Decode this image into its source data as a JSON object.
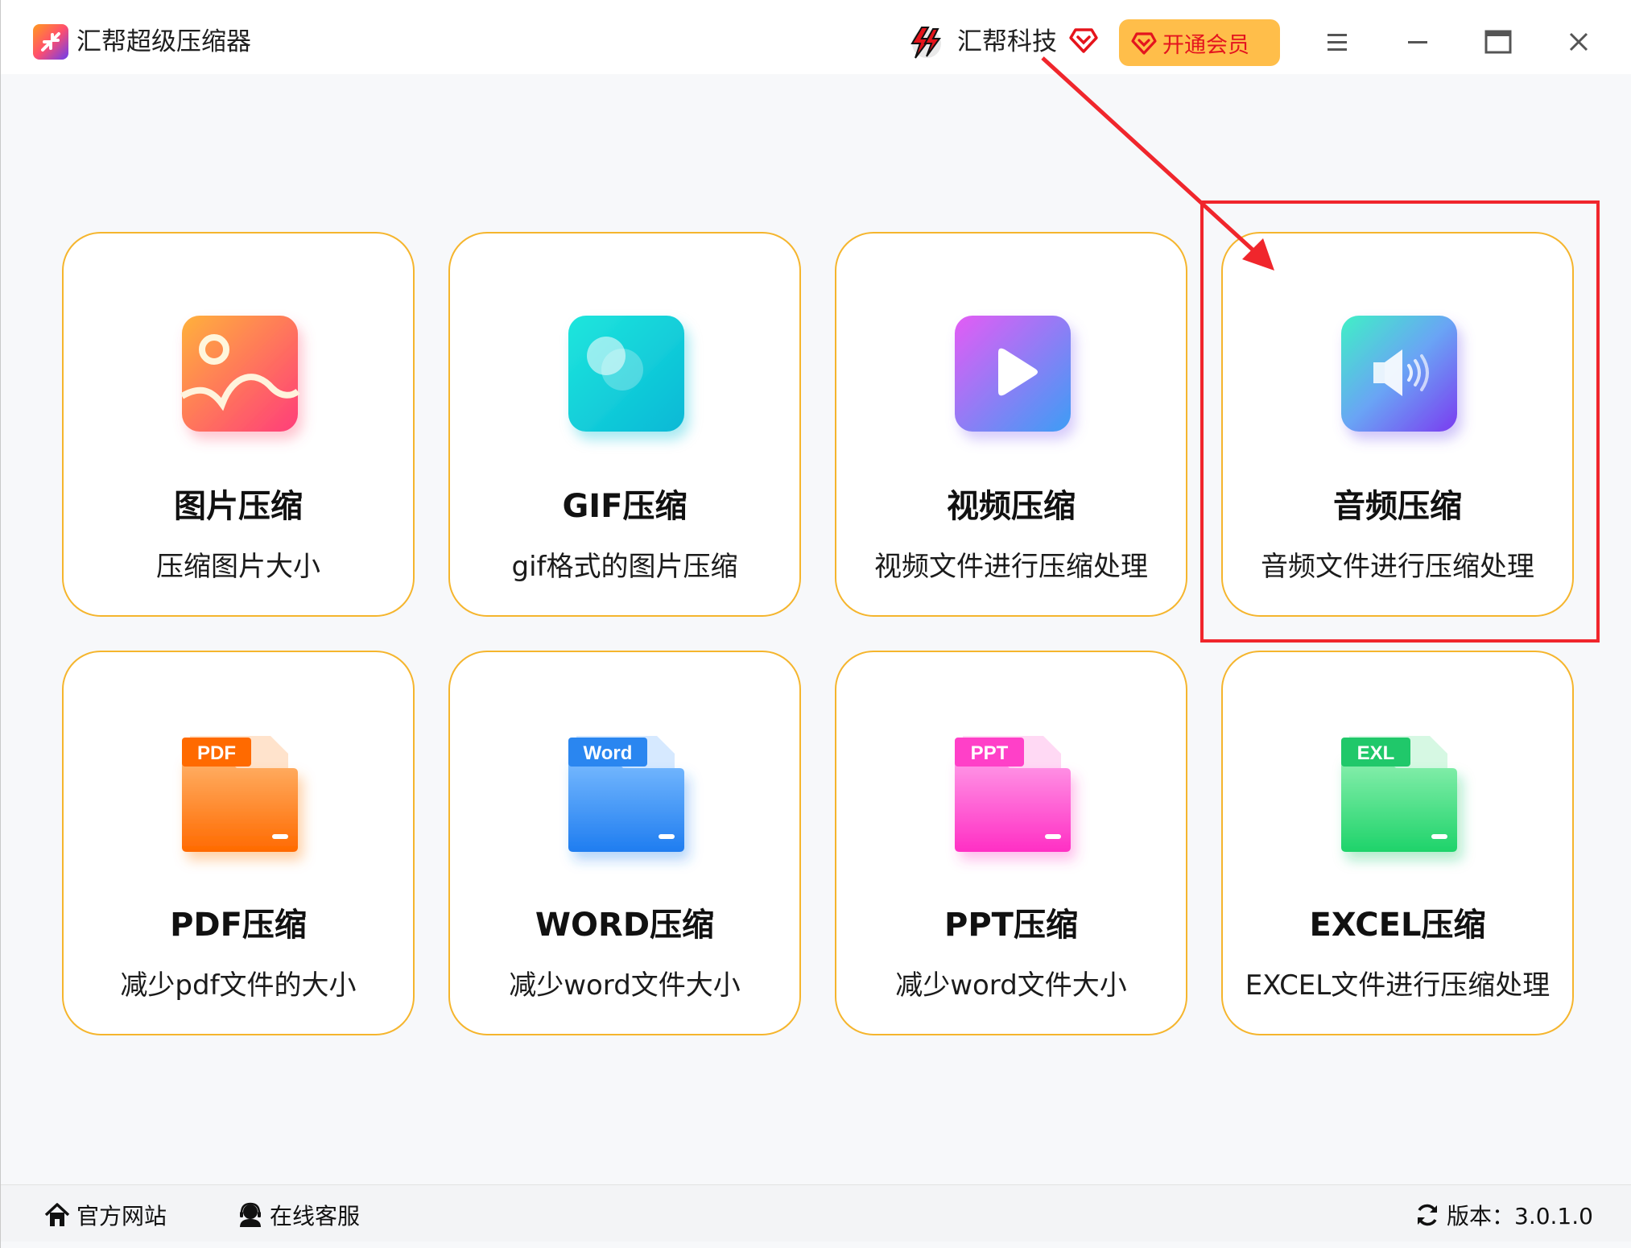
{
  "app": {
    "title": "汇帮超级压缩器",
    "brand_name": "汇帮科技",
    "vip_label": "开通会员"
  },
  "colors": {
    "card_border": "#f5b52d",
    "vip_background": "#ffbe4a",
    "vip_text": "#e4141e",
    "annotation": "#f0262c"
  },
  "window_controls": [
    "menu-icon",
    "minimize-icon",
    "maximize-icon",
    "close-icon"
  ],
  "cards": [
    {
      "title": "图片压缩",
      "desc": "压缩图片大小",
      "icon": "image-icon"
    },
    {
      "title": "GIF压缩",
      "desc": "gif格式的图片压缩",
      "icon": "gif-icon"
    },
    {
      "title": "视频压缩",
      "desc": "视频文件进行压缩处理",
      "icon": "video-play-icon"
    },
    {
      "title": "音频压缩",
      "desc": "音频文件进行压缩处理",
      "icon": "speaker-icon"
    },
    {
      "title": "PDF压缩",
      "desc": "减少pdf文件的大小",
      "icon": "pdf-folder-icon",
      "badge": "PDF"
    },
    {
      "title": "WORD压缩",
      "desc": "减少word文件大小",
      "icon": "word-folder-icon",
      "badge": "Word"
    },
    {
      "title": "PPT压缩",
      "desc": "减少word文件大小",
      "icon": "ppt-folder-icon",
      "badge": "PPT"
    },
    {
      "title": "EXCEL压缩",
      "desc": "EXCEL文件进行压缩处理",
      "icon": "excel-folder-icon",
      "badge": "EXL"
    }
  ],
  "statusbar": {
    "website": "官方网站",
    "support": "在线客服",
    "version": "版本：3.0.1.0"
  }
}
